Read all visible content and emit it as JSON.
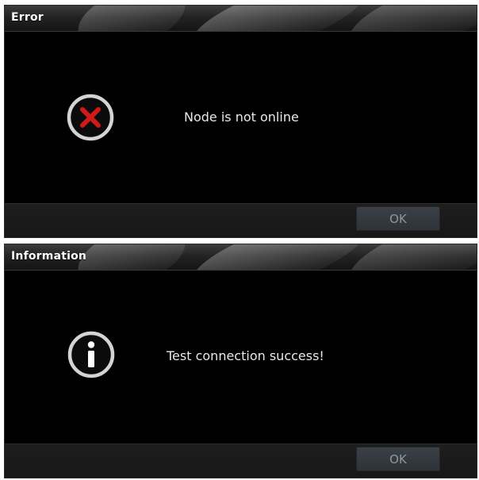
{
  "dialogs": [
    {
      "title": "Error",
      "icon": "error-x-icon",
      "message": "Node is not online",
      "ok_label": "OK",
      "icon_color": "#d01a1a"
    },
    {
      "title": "Information",
      "icon": "info-icon",
      "message": "Test connection success!",
      "ok_label": "OK",
      "icon_color": "#ffffff"
    }
  ]
}
